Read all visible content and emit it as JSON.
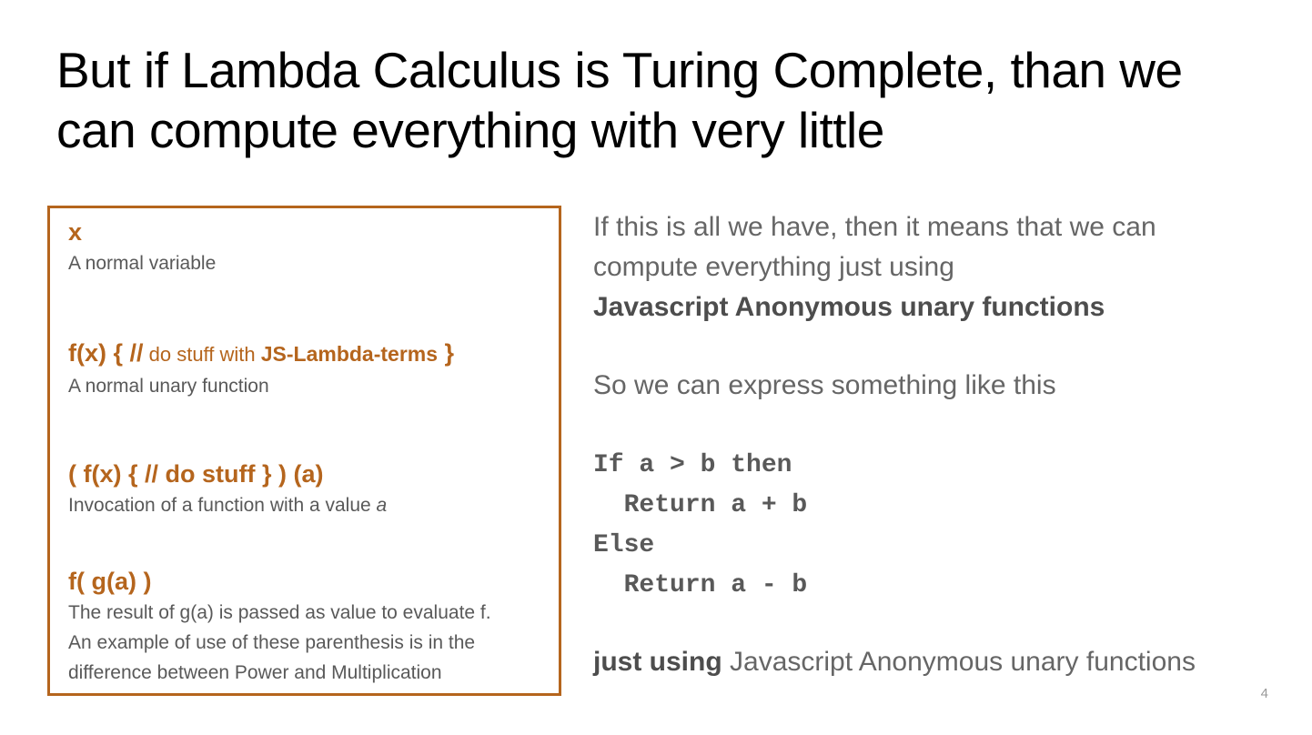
{
  "slide": {
    "title_line1": "But if Lambda Calculus is Turing Complete, than we",
    "title_line2": "can compute everything with very little",
    "page_number": "4"
  },
  "definitions": [
    {
      "term": "x",
      "desc": "A normal variable"
    },
    {
      "term_prefix": "f(x) { //",
      "term_comment": " do stuff with ",
      "term_bold": "JS-Lambda-terms",
      "term_suffix": " }",
      "desc": "A normal unary function"
    },
    {
      "term": "( f(x) { // do stuff } ) (a)",
      "desc_prefix": "Invocation of a function with a value ",
      "desc_italic": "a"
    },
    {
      "term": "f( g(a) )",
      "desc_line1": "The result of g(a) is passed as value to evaluate f.",
      "desc_line2": "An example of use of these parenthesis is in the",
      "desc_line3": "difference between Power and Multiplication"
    }
  ],
  "right": {
    "p1_line1": "If this is all we have, then it means that we can",
    "p1_line2": "compute everything just using",
    "p1_bold": "Javascript Anonymous unary functions",
    "p2": "So we can express something like this",
    "code": [
      "If a > b then",
      "  Return a + b",
      "Else",
      "  Return a - b"
    ],
    "p3_bold": "just using",
    "p3_rest": " Javascript Anonymous unary functions"
  }
}
